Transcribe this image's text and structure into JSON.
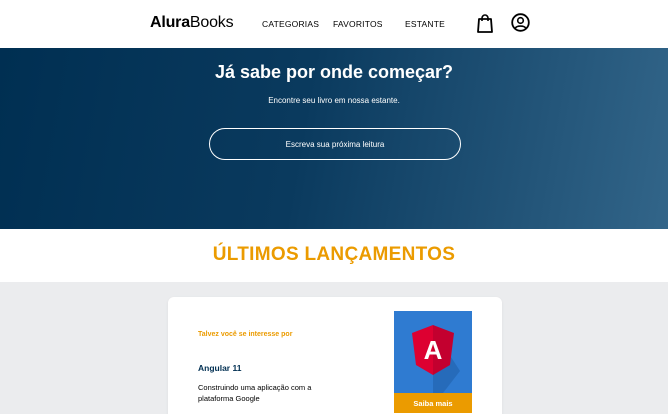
{
  "header": {
    "logo_bold": "Alura",
    "logo_light": "Books",
    "nav": [
      "CATEGORIAS",
      "FAVORITOS",
      "ESTANTE"
    ],
    "icons": [
      "shopping-bag-icon",
      "user-icon"
    ]
  },
  "hero": {
    "title": "Já sabe por onde começar?",
    "subtitle": "Encontre seu livro em nossa estante.",
    "search_placeholder": "Escreva sua próxima leitura"
  },
  "section": {
    "title": "ÚLTIMOS LANÇAMENTOS"
  },
  "card": {
    "kicker": "Talvez você se interesse por",
    "book_title": "Angular 11",
    "description": "Construindo uma aplicação com a plataforma Google",
    "button_label": "Saiba mais",
    "cover_letter": "A"
  },
  "colors": {
    "brand_blue": "#002f52",
    "accent_orange": "#eb9b00",
    "angular_red": "#dd0031"
  }
}
